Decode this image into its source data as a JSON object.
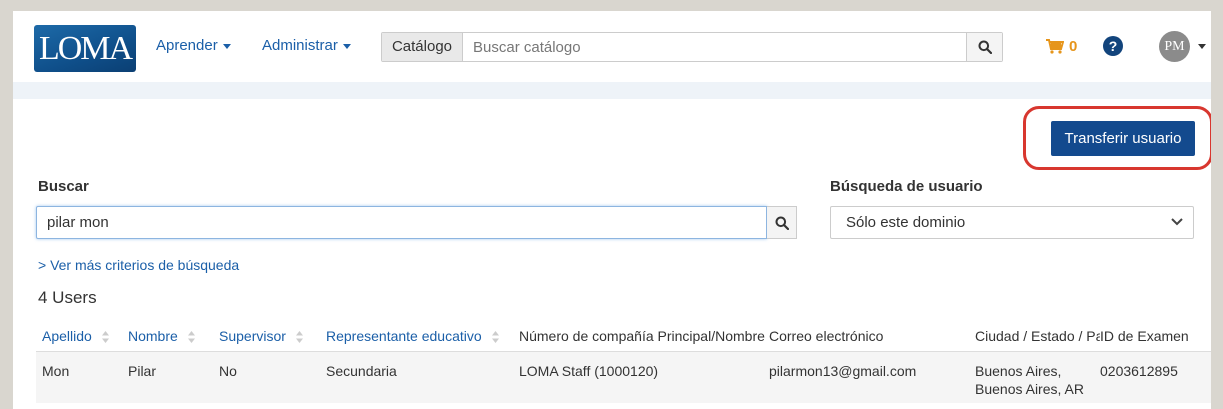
{
  "brand": {
    "logo_text": "LOMA"
  },
  "nav": {
    "learn": "Aprender",
    "admin": "Administrar",
    "catalog_label": "Catálogo",
    "catalog_placeholder": "Buscar catálogo",
    "cart_count": "0",
    "help": "?",
    "user_initials": "PM"
  },
  "actions": {
    "transfer_user": "Transferir usuario"
  },
  "search": {
    "label": "Buscar",
    "value": "pilar mon",
    "user_search_label": "Búsqueda de usuario",
    "user_search_selected": "Sólo este dominio",
    "more_criteria": "> Ver más criterios de búsqueda"
  },
  "results": {
    "count_text": "4 Users",
    "columns": [
      "Apellido",
      "Nombre",
      "Supervisor",
      "Representante educativo",
      "Número de compañía Principal/Nombre",
      "Correo electrónico",
      "Ciudad / Estado / País",
      "ID de Examen"
    ],
    "rows": [
      {
        "last_name": "Mon",
        "first_name": "Pilar",
        "supervisor": "No",
        "rep": "Secundaria",
        "company": "LOMA Staff (1000120)",
        "email": "pilarmon13@gmail.com",
        "city": "Buenos Aires, Buenos Aires, AR",
        "exam_id": "0203612895"
      }
    ]
  },
  "colors": {
    "link_blue": "#1b5fa8",
    "primary_button": "#134a8e",
    "cart_orange": "#e6951b",
    "highlight_red": "#d8372f"
  }
}
